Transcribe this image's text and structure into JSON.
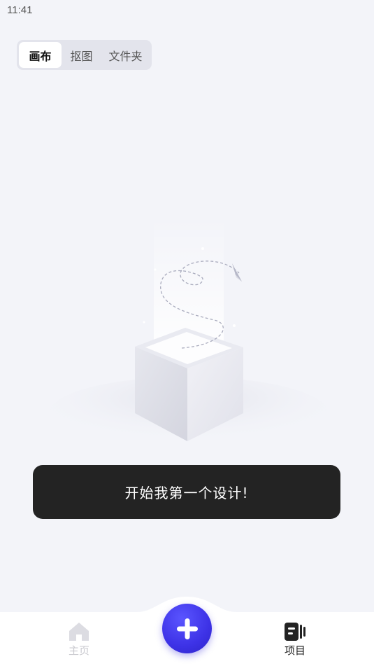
{
  "status_bar": {
    "time": "11:41"
  },
  "tabs": [
    {
      "label": "画布",
      "active": true
    },
    {
      "label": "抠图",
      "active": false
    },
    {
      "label": "文件夹",
      "active": false
    }
  ],
  "empty_state": {
    "illustration": "empty-box-icon"
  },
  "cta": {
    "label": "开始我第一个设计!"
  },
  "bottom_nav": {
    "home_label": "主页",
    "create_icon": "plus-icon",
    "projects_label": "项目"
  },
  "colors": {
    "accent": "#3d32e6",
    "cta_bg": "#232323",
    "background": "#f3f4f9"
  }
}
